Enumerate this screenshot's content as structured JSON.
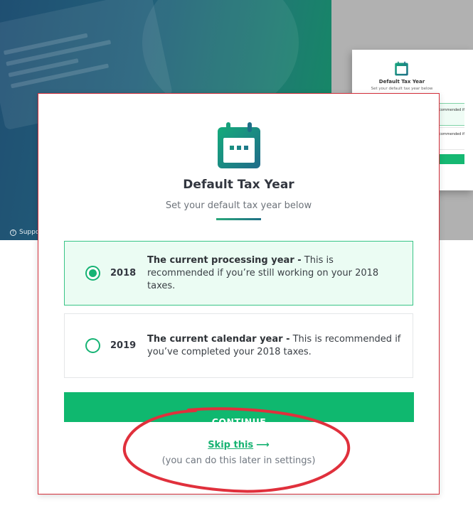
{
  "background": {
    "support_label": "Support"
  },
  "mini_modal": {
    "title": "Default Tax Year",
    "subtitle": "Set your default tax year below",
    "option1_snippet": "ecommended if",
    "option2_snippet": "ecommended if"
  },
  "modal": {
    "title": "Default Tax Year",
    "subtitle": "Set your default tax year below",
    "options": [
      {
        "year": "2018",
        "heading": "The current processing year -",
        "description": " This is recommended if you’re still working on your 2018 taxes.",
        "selected": true
      },
      {
        "year": "2019",
        "heading": "The current calendar year -",
        "description": " This is recommended if you’ve completed your 2018 taxes.",
        "selected": false
      }
    ],
    "continue_label": "CONTINUE",
    "skip_label": "Skip this",
    "skip_arrow": "⟶",
    "later_note": "(you can do this later in settings)"
  },
  "colors": {
    "accent": "#0fb86f",
    "selected_bg": "#ebfcf3",
    "annotation": "#e0303c"
  },
  "icons": {
    "calendar": "calendar-icon",
    "radio_on": "radio-selected-icon",
    "radio_off": "radio-unselected-icon",
    "arrow": "arrow-right-icon"
  }
}
